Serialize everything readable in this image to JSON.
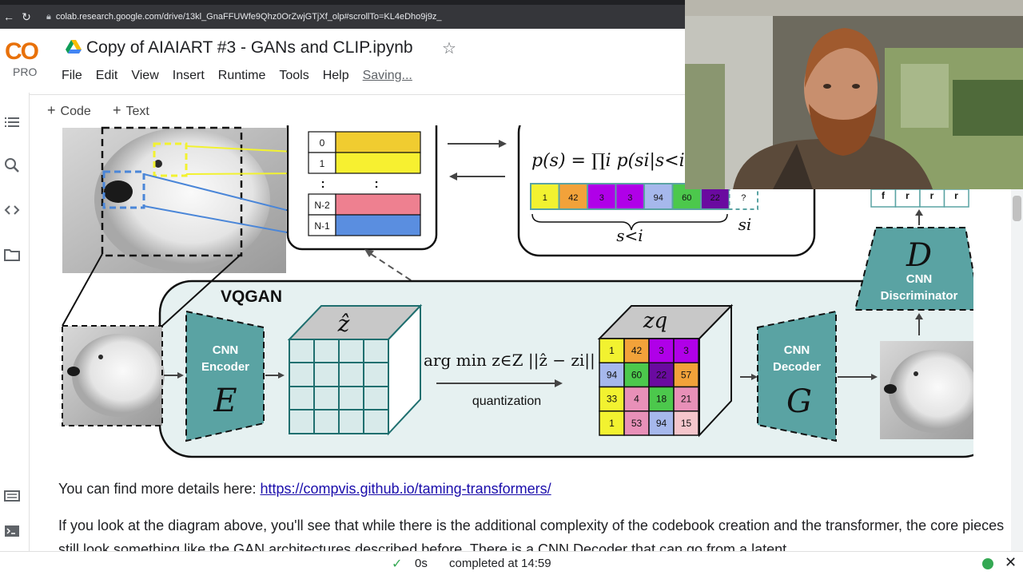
{
  "browser": {
    "url": "colab.research.google.com/drive/13kl_GnaFFUWfe9Qhz0OrZwjGTjXf_olp#scrollTo=KL4eDho9j9z_"
  },
  "app": {
    "logo_text": "CO",
    "plan": "PRO",
    "title": "Copy of AIAIART #3 - GANs and CLIP.ipynb",
    "menu": [
      "File",
      "Edit",
      "View",
      "Insert",
      "Runtime",
      "Tools",
      "Help"
    ],
    "save_status": "Saving..."
  },
  "toolbar": {
    "add_code": "Code",
    "add_text": "Text"
  },
  "rail": {
    "icons": [
      "toc-icon",
      "search-icon",
      "code-snippets-icon",
      "files-icon",
      "command-palette-icon",
      "terminal-icon"
    ]
  },
  "diagram": {
    "codebook_rows": [
      "0",
      "1",
      "N-2",
      "N-1"
    ],
    "dots": [
      ":",
      ":"
    ],
    "prob_formula": "p(s) = ∏i p(si|s<i",
    "sequence": [
      "1",
      "42",
      "3",
      "3",
      "94",
      "60",
      "22",
      "?"
    ],
    "s_less_i": "s<i",
    "s_i": "si",
    "disc_outputs": [
      "f",
      "r",
      "r",
      "r"
    ],
    "disc_letter": "D",
    "disc_label": "CNN Discriminator",
    "vqgan_label": "VQGAN",
    "encoder_label": "CNN Encoder",
    "encoder_letter": "E",
    "zhat_label": "ẑ",
    "argmin_text": "arg min z∈Z ||ẑ − zi||",
    "quantization_label": "quantization",
    "zq_label": "zq",
    "zq_grid": [
      "1",
      "42",
      "3",
      "3",
      "94",
      "60",
      "22",
      "57",
      "33",
      "4",
      "18",
      "21",
      "1",
      "53",
      "94",
      "15"
    ],
    "decoder_label": "CNN Decoder",
    "decoder_letter": "G",
    "colors": {
      "teal": "#5aa3a3",
      "yellow": "#f2f230",
      "orange": "#f2a23a",
      "purple": "#b000e8",
      "blue": "#a6b8ec",
      "green": "#4cc84c",
      "darkpurple": "#6a0aa0",
      "pink": "#e890b8",
      "lightpink": "#f5c6cc"
    }
  },
  "text": {
    "para1_prefix": "You can find more details here: ",
    "para1_link": "https://compvis.github.io/taming-transformers/",
    "para2": "If you look at the diagram above, you'll see that while there is the additional complexity of the codebook creation and the transformer, the core pieces still look something like the GAN architectures described before. There is a CNN Decoder that can go from a latent"
  },
  "status": {
    "duration": "0s",
    "completed": "completed at 14:59"
  }
}
